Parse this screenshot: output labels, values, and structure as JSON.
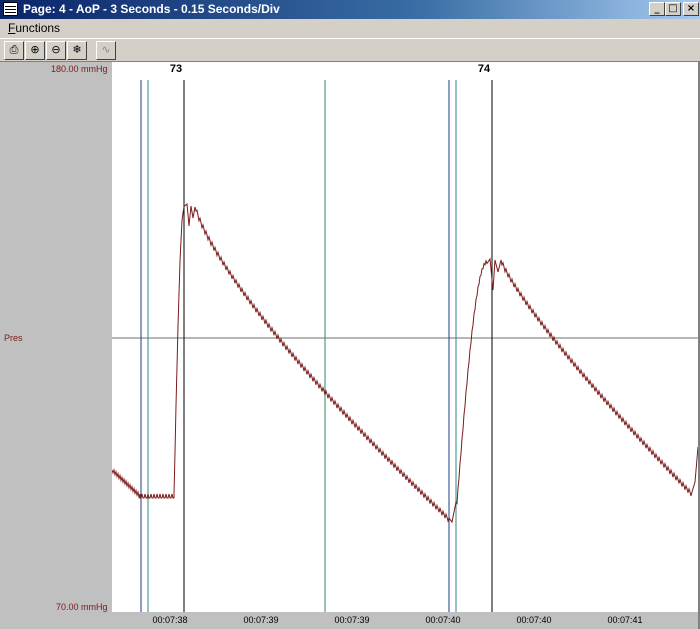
{
  "window": {
    "title": "Page: 4 - AoP - 3 Seconds - 0.15 Seconds/Div",
    "min_glyph": "_",
    "max_glyph": "□",
    "close_glyph": "×"
  },
  "menu": {
    "functions_prefix": "F",
    "functions_rest": "unctions"
  },
  "toolbar": [
    {
      "name": "print-icon",
      "glyph": "⎙"
    },
    {
      "name": "zoom-in-icon",
      "glyph": "⊕"
    },
    {
      "name": "zoom-out-icon",
      "glyph": "⊖"
    },
    {
      "name": "snowflake-icon",
      "glyph": "❄"
    },
    {
      "name": "waveform-icon",
      "glyph": "∿"
    }
  ],
  "axis": {
    "y_max_label": "180.00 mmHg",
    "y_min_label": "70.00 mmHg",
    "channel_label": "Pres"
  },
  "beats": [
    "73",
    "74"
  ],
  "time_ticks": [
    "00:07:38",
    "00:07:39",
    "00:07:39",
    "00:07:40",
    "00:07:40",
    "00:07:41"
  ],
  "colors": {
    "trace": "#7a1a1a",
    "blue_marker": "#1f3a8a",
    "teal_marker": "#2a8a8a",
    "green_marker": "#2e8b57",
    "black_marker": "#000000"
  }
}
